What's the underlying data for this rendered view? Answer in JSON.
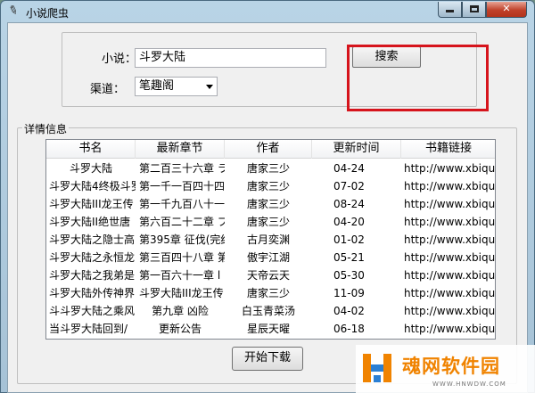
{
  "window": {
    "title": "小说爬虫",
    "icon": "feather-icon",
    "controls": {
      "minimize": "minimize-icon",
      "maximize": "maximize-icon",
      "close": "✕"
    }
  },
  "search": {
    "novel_label": "小说：",
    "novel_value": "斗罗大陆",
    "channel_label": "渠道：",
    "channel_value": "笔趣阁",
    "search_button": "搜索"
  },
  "details": {
    "group_title": "详情信息",
    "columns": [
      "书名",
      "最新章节",
      "作者",
      "更新时间",
      "书籍链接"
    ],
    "rows": [
      [
        "斗罗大陆",
        "第二百三十六章 ラ",
        "唐家三少",
        "04-24",
        "http://www.xbiqu"
      ],
      [
        "斗罗大陆4终极斗罗",
        "第一千一百四十四",
        "唐家三少",
        "07-02",
        "http://www.xbiqu"
      ],
      [
        "斗罗大陆III龙王传",
        "第一千九百八十一",
        "唐家三少",
        "08-24",
        "http://www.xbiqu"
      ],
      [
        "斗罗大陆II绝世唐",
        "第六百二十二章 プ",
        "唐家三少",
        "04-20",
        "http://www.xbiqu"
      ],
      [
        "斗罗大陆之隐士高",
        "第395章 征伐(完结",
        "古月奕渊",
        "01-02",
        "http://www.xbiqu"
      ],
      [
        "斗罗大陆之永恒龙",
        "第三百四十八章 第",
        "傲宇江湖",
        "05-21",
        "http://www.xbiqu"
      ],
      [
        "斗罗大陆之我弟是",
        "第一百六十一章 l",
        "天帝云天",
        "05-30",
        "http://www.xbiqu"
      ],
      [
        "斗罗大陆外传神界",
        "斗罗大陆III龙王传",
        "唐家三少",
        "11-09",
        "http://www.xbiqu"
      ],
      [
        "斗斗罗大陆之乘风",
        "第九章 凶险",
        "白玉青菜汤",
        "04-02",
        "http://www.xbiqu"
      ],
      [
        "当斗罗大陆回到/",
        "更新公告",
        "星辰天曜",
        "06-18",
        "http://www.xbiqu"
      ]
    ]
  },
  "actions": {
    "download_button": "开始下载"
  },
  "watermark": {
    "text": "魂网软件园",
    "sub": "WWW.HNWDW.COM"
  },
  "colors": {
    "highlight": "#d6141c",
    "watermark": "#f08300"
  }
}
